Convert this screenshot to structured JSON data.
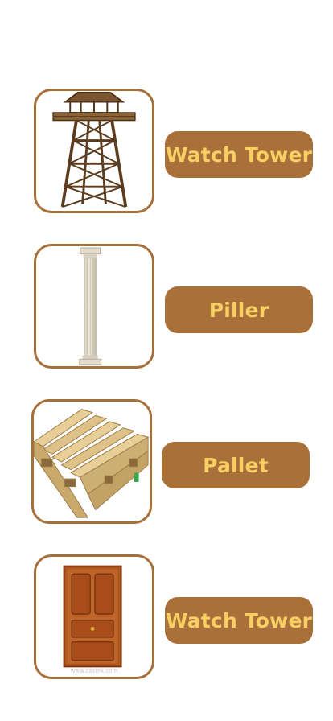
{
  "items": [
    {
      "label": "Watch Tower",
      "image": "watch-tower"
    },
    {
      "label": "Piller",
      "image": "pillar"
    },
    {
      "label": "Pallet",
      "image": "pallet"
    },
    {
      "label": "Watch Tower",
      "image": "door"
    }
  ],
  "watermark": "www.castek.com",
  "colors": {
    "border": "#a5703a",
    "button": "#a9703a",
    "button_text": "#f8cf62"
  }
}
